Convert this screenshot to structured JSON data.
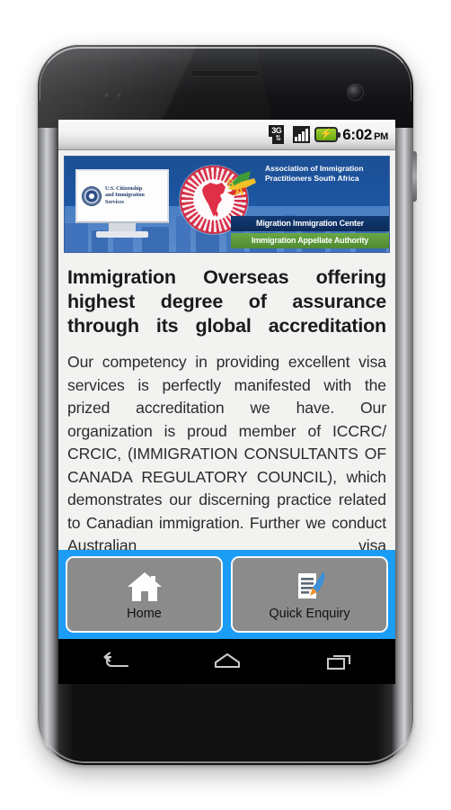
{
  "device": {
    "type": "android-smartphone",
    "body_color": "#121213",
    "bezel_chrome": "#cfd0d2"
  },
  "statusbar": {
    "network_label": "3G",
    "network_arrows": "⇅",
    "signal_icon": "signal-bars-icon",
    "battery_icon": "battery-charging-icon",
    "battery_color": "#8cc42a",
    "time": "6:02",
    "meridiem": "PM"
  },
  "banner": {
    "alt": "immigration accreditation banner",
    "bg_top_color": "#1d56a2",
    "bg_bottom_color": "#5b8bcb",
    "uscis": {
      "line1": "U.S. Citizenship",
      "line2": "and Immigration",
      "line3": "Services"
    },
    "india_seal_label": "india-government-seal",
    "aipsa": {
      "title_line1": "Association of Immigration",
      "title_line2": "Practitioners South Africa",
      "bar_navy": "Migration Immigration Center",
      "bar_green": "Immigration Appellate Authority",
      "navy_color": "#0c2b58",
      "green_color": "#4f8a31"
    }
  },
  "article": {
    "headline": "Immigration Overseas offering highest degree of assurance through its global accreditation",
    "body": "Our competency in providing excellent visa services is perfectly manifested with the prized accreditation we have. Our organization is proud member of ICCRC/ CRCIC, (IMMIGRATION CONSULTANTS OF CANADA REGULATORY COUNCIL), which demonstrates our discerning practice related to Canadian immigration. Further we conduct Australian visa"
  },
  "toolbar": {
    "accent_color": "#1b9cf5",
    "button_color": "#8b8b8b",
    "buttons": [
      {
        "label": "Home",
        "icon": "home-icon"
      },
      {
        "label": "Quick Enquiry",
        "icon": "document-pen-icon"
      }
    ]
  },
  "navbar": {
    "back": "back-icon",
    "home": "home-nav-icon",
    "recents": "recent-apps-icon"
  }
}
